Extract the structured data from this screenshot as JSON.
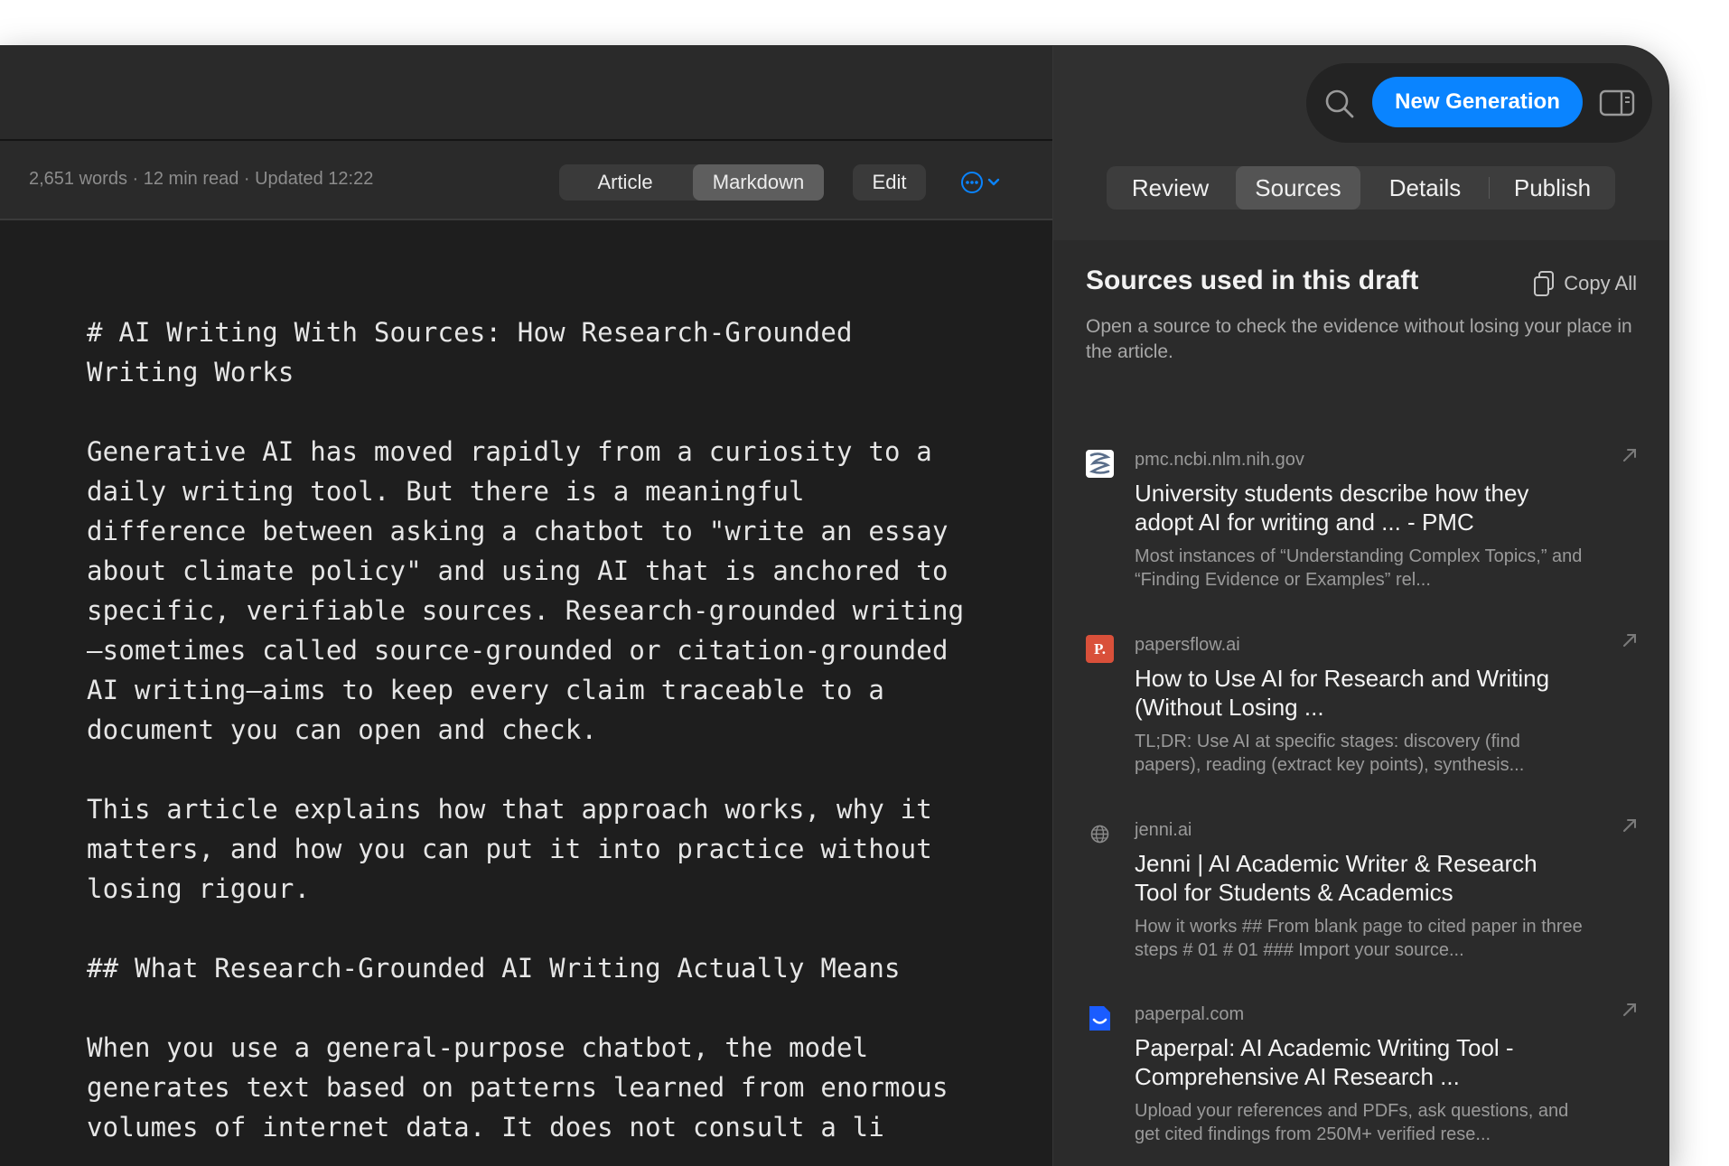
{
  "editor": {
    "meta": "2,651 words · 12 min read · Updated 12:22",
    "view_tabs": [
      "Article",
      "Markdown"
    ],
    "edit_label": "Edit",
    "content": [
      "# AI Writing With Sources: How Research-Grounded\nWriting Works",
      "Generative AI has moved rapidly from a curiosity to a\ndaily writing tool. But there is a meaningful\ndifference between asking a chatbot to \"write an essay\nabout climate policy\" and using AI that is anchored to\nspecific, verifiable sources. Research-grounded writing\n—sometimes called source-grounded or citation-grounded\nAI writing—aims to keep every claim traceable to a\ndocument you can open and check.",
      "This article explains how that approach works, why it\nmatters, and how you can put it into practice without\nlosing rigour.",
      "## What Research-Grounded AI Writing Actually Means",
      "When you use a general-purpose chatbot, the model\ngenerates text based on patterns learned from enormous\nvolumes of internet data. It does not consult a li"
    ]
  },
  "panel": {
    "new_generation_label": "New Generation",
    "tabs": [
      "Review",
      "Sources",
      "Details",
      "Publish"
    ],
    "active_tab": "Sources",
    "section_title": "Sources used in this draft",
    "copy_all_label": "Copy All",
    "section_desc": "Open a source to check the evidence without losing your place in the article.",
    "sources": [
      {
        "domain": "pmc.ncbi.nlm.nih.gov",
        "title": "University students describe how they adopt AI for writing and ... - PMC",
        "snippet": "Most instances of “Understanding Complex Topics,” and “Finding Evidence or Examples” rel...",
        "icon": "pmc-favicon"
      },
      {
        "domain": "papersflow.ai",
        "title": "How to Use AI for Research and Writing (Without Losing ...",
        "snippet": "TL;DR: Use AI at specific stages: discovery (find papers), reading (extract key points), synthesis...",
        "icon": "papersflow-favicon",
        "icon_letter": "P."
      },
      {
        "domain": "jenni.ai",
        "title": "Jenni | AI Academic Writer & Research Tool for Students & Academics",
        "snippet": "How it works ## From blank page to cited paper in three steps # 01 # 01 ### Import your source...",
        "icon": "globe-icon"
      },
      {
        "domain": "paperpal.com",
        "title": "Paperpal: AI Academic Writing Tool - Comprehensive AI Research ...",
        "snippet": "Upload your references and PDFs, ask questions, and get cited findings from 250M+ verified rese...",
        "icon": "paperpal-favicon"
      }
    ]
  },
  "colors": {
    "accent": "#0a84ff",
    "editor_bg": "#1e1e1e",
    "panel_bg": "#2b2b2b",
    "papersflow_red": "#d9503a",
    "paperpal_blue": "#1a5cff"
  }
}
